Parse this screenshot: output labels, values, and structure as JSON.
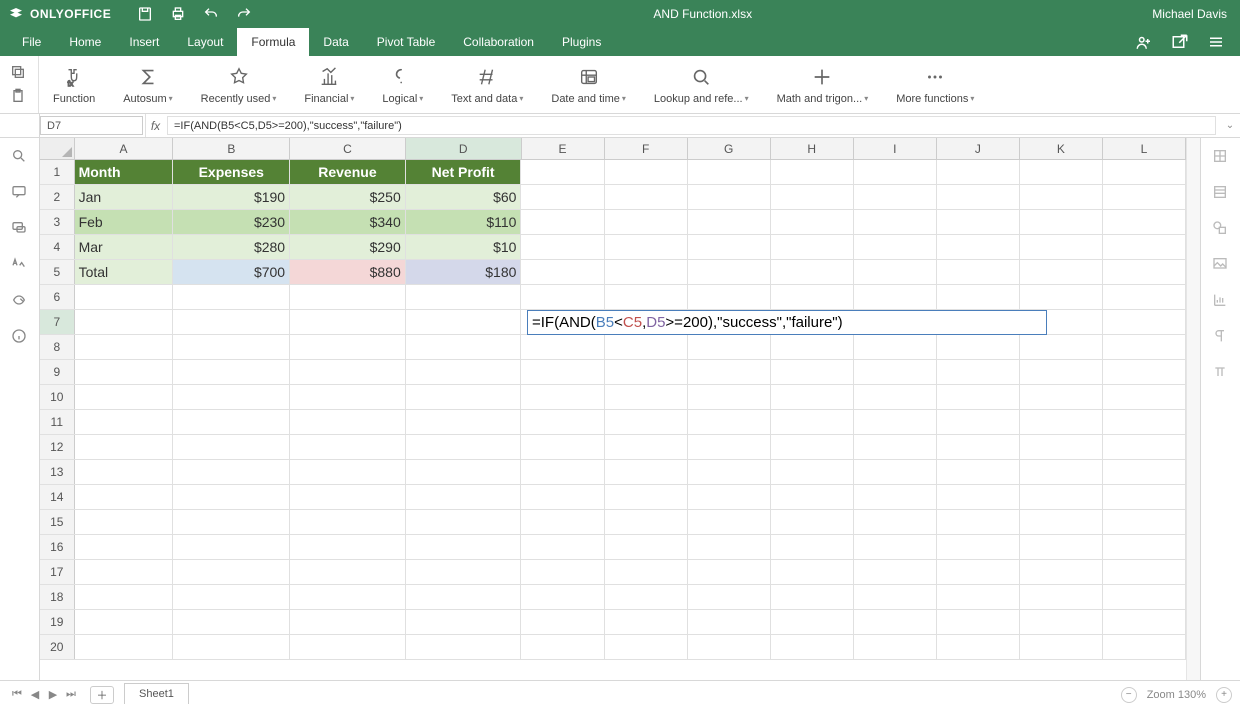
{
  "app": {
    "name": "ONLYOFFICE",
    "document_title": "AND Function.xlsx",
    "user": "Michael Davis"
  },
  "menu": {
    "items": [
      "File",
      "Home",
      "Insert",
      "Layout",
      "Formula",
      "Data",
      "Pivot Table",
      "Collaboration",
      "Plugins"
    ],
    "active_index": 4
  },
  "ribbon": {
    "groups": [
      {
        "label": "Function"
      },
      {
        "label": "Autosum",
        "caret": true
      },
      {
        "label": "Recently used",
        "caret": true
      },
      {
        "label": "Financial",
        "caret": true
      },
      {
        "label": "Logical",
        "caret": true
      },
      {
        "label": "Text and data",
        "caret": true
      },
      {
        "label": "Date and time",
        "caret": true
      },
      {
        "label": "Lookup and refe...",
        "caret": true
      },
      {
        "label": "Math and trigon...",
        "caret": true
      },
      {
        "label": "More functions",
        "caret": true
      }
    ]
  },
  "namebox": "D7",
  "formula_bar": "=IF(AND(B5<C5,D5>=200),\"success\",\"failure\")",
  "columns": [
    "A",
    "B",
    "C",
    "D",
    "E",
    "F",
    "G",
    "H",
    "I",
    "J",
    "K",
    "L"
  ],
  "row_count": 20,
  "table": {
    "headers": [
      "Month",
      "Expenses",
      "Revenue",
      "Net Profit"
    ],
    "rows": [
      {
        "month": "Jan",
        "expenses": "$190",
        "revenue": "$250",
        "profit": "$60"
      },
      {
        "month": "Feb",
        "expenses": "$230",
        "revenue": "$340",
        "profit": "$110"
      },
      {
        "month": "Mar",
        "expenses": "$280",
        "revenue": "$290",
        "profit": "$10"
      }
    ],
    "total": {
      "label": "Total",
      "expenses": "$700",
      "revenue": "$880",
      "profit": "$180"
    }
  },
  "editing_formula": {
    "parts": [
      {
        "t": "=IF(AND(",
        "c": "black"
      },
      {
        "t": "B5",
        "c": "blue"
      },
      {
        "t": "<",
        "c": "black"
      },
      {
        "t": "C5",
        "c": "red"
      },
      {
        "t": ",",
        "c": "black"
      },
      {
        "t": "D5",
        "c": "purple"
      },
      {
        "t": ">=200),\"success\",\"failure\")",
        "c": "black"
      }
    ]
  },
  "sheet_tabs": {
    "active": "Sheet1"
  },
  "status": {
    "zoom_label": "Zoom 130%"
  }
}
